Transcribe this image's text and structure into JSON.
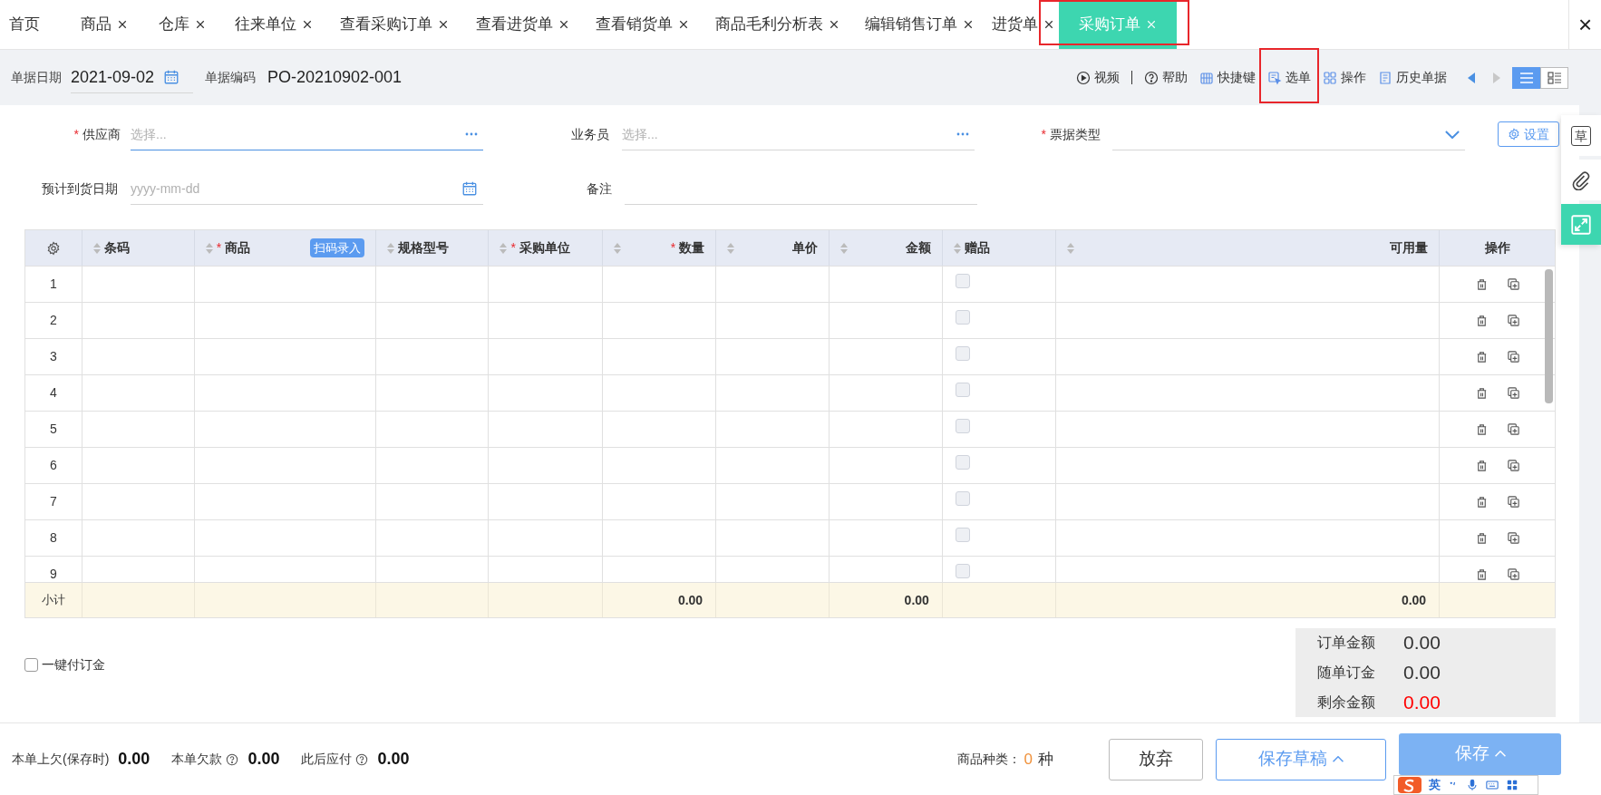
{
  "tabs": [
    {
      "label": "首页",
      "closable": false,
      "selected": false,
      "outlined": false
    },
    {
      "label": "商品",
      "closable": true,
      "selected": false,
      "outlined": false
    },
    {
      "label": "仓库",
      "closable": true,
      "selected": false,
      "outlined": false
    },
    {
      "label": "往来单位",
      "closable": true,
      "selected": false,
      "outlined": false
    },
    {
      "label": "查看采购订单",
      "closable": true,
      "selected": false,
      "outlined": false
    },
    {
      "label": "查看进货单",
      "closable": true,
      "selected": false,
      "outlined": false
    },
    {
      "label": "查看销货单",
      "closable": true,
      "selected": false,
      "outlined": false
    },
    {
      "label": "商品毛利分析表",
      "closable": true,
      "selected": false,
      "outlined": false
    },
    {
      "label": "编辑销售订单",
      "closable": true,
      "selected": false,
      "outlined": false
    },
    {
      "label": "进货单",
      "closable": true,
      "selected": false,
      "outlined": false
    },
    {
      "label": "采购订单",
      "closable": true,
      "selected": true,
      "outlined": true
    }
  ],
  "close_all": "×",
  "header": {
    "date_label": "单据日期",
    "date": "2021-09-02",
    "code_label": "单据编码",
    "code": "PO-20210902-001"
  },
  "actions": [
    {
      "label": "视频",
      "kind": "video",
      "outlined": false
    },
    {
      "label": "帮助",
      "kind": "help",
      "outlined": false
    },
    {
      "label": "快捷键",
      "kind": "keys",
      "outlined": false
    },
    {
      "label": "选单",
      "kind": "pick",
      "outlined": true
    },
    {
      "label": "操作",
      "kind": "ops",
      "outlined": false
    },
    {
      "label": "历史单据",
      "kind": "history",
      "outlined": false
    }
  ],
  "views": [
    {
      "kind": "list",
      "selected": true
    },
    {
      "kind": "detail",
      "selected": false
    }
  ],
  "form_rows": [
    [
      {
        "label": "供应商",
        "required_mark": "*",
        "placeholder": "选择...",
        "kind": "dots",
        "focused": true
      },
      {
        "label": "业务员",
        "placeholder": "选择...",
        "kind": "dots",
        "focused": false
      },
      {
        "label": "票据类型",
        "required_mark": "*",
        "kind": "select",
        "focused": false
      }
    ],
    [
      {
        "label": "预计到货日期",
        "placeholder": "yyyy-mm-dd",
        "kind": "date",
        "focused": false
      },
      {
        "label": "备注",
        "kind": "text",
        "focused": false
      }
    ]
  ],
  "settings_button": "设置",
  "columns": [
    {
      "kind": "gear"
    },
    {
      "label": "条码"
    },
    {
      "label": "商品",
      "required_mark": "*",
      "badge": "扫码录入"
    },
    {
      "label": "规格型号"
    },
    {
      "label": "采购单位",
      "required_mark": "*"
    },
    {
      "label": "数量",
      "required_mark": "*",
      "total": "0.00"
    },
    {
      "label": "单价"
    },
    {
      "label": "金额",
      "total": "0.00"
    },
    {
      "label": "赠品",
      "kind": "gift"
    },
    {
      "label": "可用量",
      "total": "0.00"
    },
    {
      "label": "操作",
      "kind": "ops"
    }
  ],
  "rows": [
    {
      "no": "1",
      "gift": false
    },
    {
      "no": "2",
      "gift": false
    },
    {
      "no": "3",
      "gift": false
    },
    {
      "no": "4",
      "gift": false
    },
    {
      "no": "5",
      "gift": false
    },
    {
      "no": "6",
      "gift": false
    },
    {
      "no": "7",
      "gift": false
    },
    {
      "no": "8",
      "gift": false
    },
    {
      "no": "9",
      "gift": false
    }
  ],
  "subtotal_label": "小计",
  "deposit": {
    "label": "一键付订金",
    "checked": false
  },
  "summary": [
    {
      "label": "订单金额",
      "value": "0.00",
      "alert": false
    },
    {
      "label": "随单订金",
      "value": "0.00",
      "alert": false
    },
    {
      "label": "剩余金额",
      "value": "0.00",
      "alert": true
    }
  ],
  "side_tools": [
    {
      "kind": "draft",
      "label": "草",
      "active": false
    },
    {
      "kind": "attach",
      "active": false
    },
    {
      "kind": "expand",
      "active": true
    }
  ],
  "footer": {
    "stats": [
      {
        "label": "本单上欠(保存时)",
        "value": "0.00",
        "help": false
      },
      {
        "label": "本单欠款",
        "value": "0.00",
        "help": true
      },
      {
        "label": "此后应付",
        "value": "0.00",
        "help": true
      }
    ],
    "kinds_label": "商品种类：",
    "kinds_count": "0",
    "kinds_unit": "种",
    "buttons": [
      {
        "label": "放弃",
        "kind": "plain",
        "caret": false
      },
      {
        "label": "保存草稿",
        "kind": "outline",
        "caret": true
      },
      {
        "label": "保存",
        "kind": "primary",
        "caret": true
      }
    ]
  },
  "ime": {
    "label": "英"
  }
}
